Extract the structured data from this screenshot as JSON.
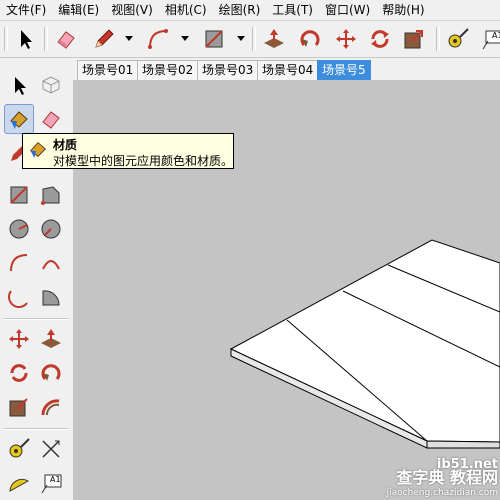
{
  "menu": [
    "文件(F)",
    "编辑(E)",
    "视图(V)",
    "相机(C)",
    "绘图(R)",
    "工具(T)",
    "窗口(W)",
    "帮助(H)"
  ],
  "toolbar": {
    "items": [
      "select-arrow-icon",
      "eraser-icon",
      "pencil-icon",
      "arc-icon",
      "rectangle-icon",
      "push-pull-icon",
      "rotate-icon",
      "move-icon",
      "rotate-arrows-icon",
      "scale-icon",
      "tape-measure-icon",
      "text-icon"
    ],
    "text_label": "A1"
  },
  "tabs": [
    "场景号01",
    "场景号02",
    "场景号03",
    "场景号04",
    "场景号5"
  ],
  "active_tab": "场景号5",
  "tooltip": {
    "title": "材质",
    "description": "对模型中的图元应用颜色和材质。"
  },
  "sidebar": {
    "text_label": "A1"
  },
  "watermark": {
    "site": "ib51.net",
    "main": "查字典 教程网",
    "url": "jiaocheng.chazidian.com"
  },
  "colors": {
    "viewport": "#c4c4c4",
    "active_tab": "#3c8ddc",
    "tooltip_bg": "#ffffe1"
  }
}
